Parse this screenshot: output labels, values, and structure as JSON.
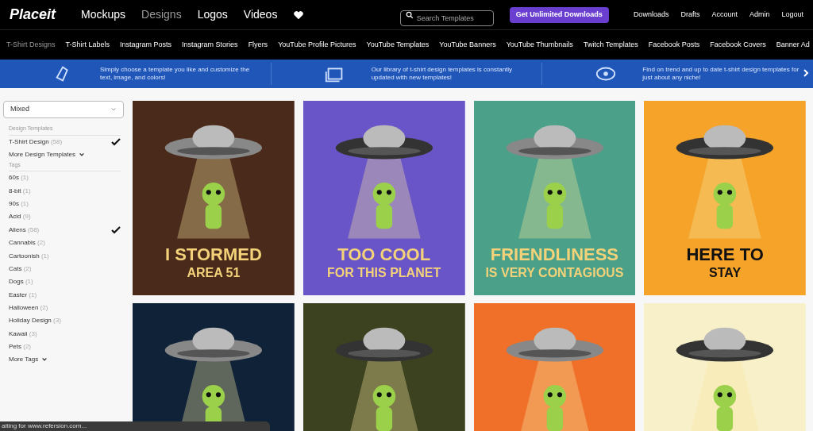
{
  "header": {
    "logo": "Placeit",
    "nav": [
      {
        "label": "Mockups",
        "selected": false
      },
      {
        "label": "Designs",
        "selected": true
      },
      {
        "label": "Logos",
        "selected": false
      },
      {
        "label": "Videos",
        "selected": false
      }
    ],
    "search": {
      "placeholder": "Search Templates"
    },
    "cta": "Get Unlimited Downloads",
    "links": [
      "Downloads",
      "Drafts",
      "Account",
      "Admin",
      "Logout"
    ]
  },
  "categories": [
    {
      "label": "T-Shirt Designs",
      "selected": true
    },
    {
      "label": "T-Shirt Labels",
      "selected": false
    },
    {
      "label": "Instagram Posts",
      "selected": false
    },
    {
      "label": "Instagram Stories",
      "selected": false
    },
    {
      "label": "Flyers",
      "selected": false
    },
    {
      "label": "YouTube Profile Pictures",
      "selected": false
    },
    {
      "label": "YouTube Templates",
      "selected": false
    },
    {
      "label": "YouTube Banners",
      "selected": false
    },
    {
      "label": "YouTube Thumbnails",
      "selected": false
    },
    {
      "label": "Twitch Templates",
      "selected": false
    },
    {
      "label": "Facebook Posts",
      "selected": false
    },
    {
      "label": "Facebook Covers",
      "selected": false
    },
    {
      "label": "Banner Ad",
      "selected": false
    }
  ],
  "banner": [
    {
      "kind": "hand",
      "lines": [
        "Simply choose a template you like and customize the",
        "text, image, and colors!"
      ]
    },
    {
      "kind": "stack",
      "lines": [
        "Our library of t-shirt design templates is constantly",
        "updated with new templates!"
      ]
    },
    {
      "kind": "eye",
      "lines": [
        "Find on trend and up to date t-shirt design templates for",
        "just about any niche!"
      ]
    }
  ],
  "sidebar": {
    "sort": "Mixed",
    "design_heading": "Design Templates",
    "design_items": [
      {
        "name": "T-Shirt Design",
        "count": "(58)",
        "checked": true
      }
    ],
    "more_design": "More Design Templates",
    "tags_heading": "Tags",
    "tags": [
      {
        "name": "60s",
        "count": "(1)",
        "checked": false
      },
      {
        "name": "8-bit",
        "count": "(1)",
        "checked": false
      },
      {
        "name": "90s",
        "count": "(1)",
        "checked": false
      },
      {
        "name": "Acid",
        "count": "(9)",
        "checked": false
      },
      {
        "name": "Aliens",
        "count": "(58)",
        "checked": true
      },
      {
        "name": "Cannabis",
        "count": "(2)",
        "checked": false
      },
      {
        "name": "Cartoonish",
        "count": "(1)",
        "checked": false
      },
      {
        "name": "Cats",
        "count": "(2)",
        "checked": false
      },
      {
        "name": "Dogs",
        "count": "(1)",
        "checked": false
      },
      {
        "name": "Easter",
        "count": "(1)",
        "checked": false
      },
      {
        "name": "Halloween",
        "count": "(2)",
        "checked": false
      },
      {
        "name": "Holiday Design",
        "count": "(3)",
        "checked": false
      },
      {
        "name": "Kawaii",
        "count": "(3)",
        "checked": false
      },
      {
        "name": "Pets",
        "count": "(2)",
        "checked": false
      }
    ],
    "more_tags": "More Tags"
  },
  "designs": [
    {
      "color": "#4a2a1a",
      "lines": [
        "I STORMED",
        "AREA 51"
      ]
    },
    {
      "color": "#6a55c8",
      "lines": [
        "TOO COOL",
        "FOR THIS PLANET"
      ]
    },
    {
      "color": "#4aa088",
      "lines": [
        "FRIENDLINESS",
        "IS VERY CONTAGIOUS"
      ]
    },
    {
      "color": "#f6a32a",
      "lines": [
        "HERE TO",
        "STAY"
      ]
    },
    {
      "color": "#0f2238"
    },
    {
      "color": "#3c4220"
    },
    {
      "color": "#f0702a"
    },
    {
      "color": "#f8f0c8"
    }
  ],
  "status": "aiting for www.refersion.com..."
}
